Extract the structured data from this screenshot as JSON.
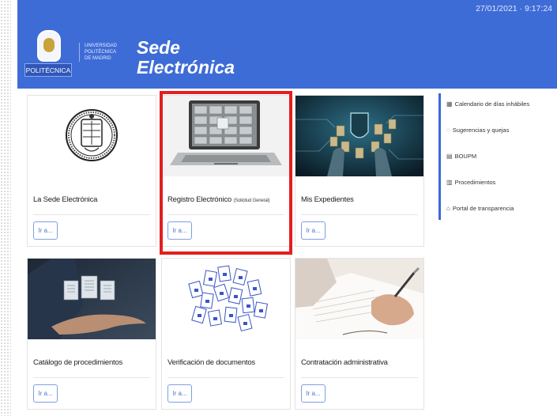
{
  "header": {
    "datetime": "27/01/2021 · 9:17:24",
    "logo_word": "POLITÉCNICA",
    "university_lines": [
      "UNIVERSIDAD",
      "POLITÉCNICA",
      "DE MADRID"
    ],
    "title_line1": "Sede",
    "title_line2": "Electrónica",
    "background_color": "#3e6cd6"
  },
  "tiles": [
    {
      "title": "La Sede Electrónica",
      "subtitle": "",
      "button": "Ir a..."
    },
    {
      "title": "Registro Electrónico",
      "subtitle": "(Solicitud General)",
      "button": "Ir a..."
    },
    {
      "title": "Mis Expedientes",
      "subtitle": "",
      "button": "Ir a..."
    },
    {
      "title": "Catálogo de procedimientos",
      "subtitle": "",
      "button": "Ir a..."
    },
    {
      "title": "Verificación de documentos",
      "subtitle": "",
      "button": "Ir a..."
    },
    {
      "title": "Contratación administrativa",
      "subtitle": "",
      "button": "Ir a..."
    }
  ],
  "sidebar": {
    "items": [
      {
        "icon": "calendar-icon",
        "label": "Calendario de días inhábiles"
      },
      {
        "icon": "comment-icon",
        "label": "Sugerencias y quejas"
      },
      {
        "icon": "document-icon",
        "label": "BOUPM"
      },
      {
        "icon": "list-icon",
        "label": "Procedimientos"
      },
      {
        "icon": "building-icon",
        "label": "Portal de transparencia"
      }
    ],
    "accent_color": "#3d69d4"
  },
  "highlight": {
    "color": "#e41e1e",
    "target": "Registro Electrónico"
  }
}
